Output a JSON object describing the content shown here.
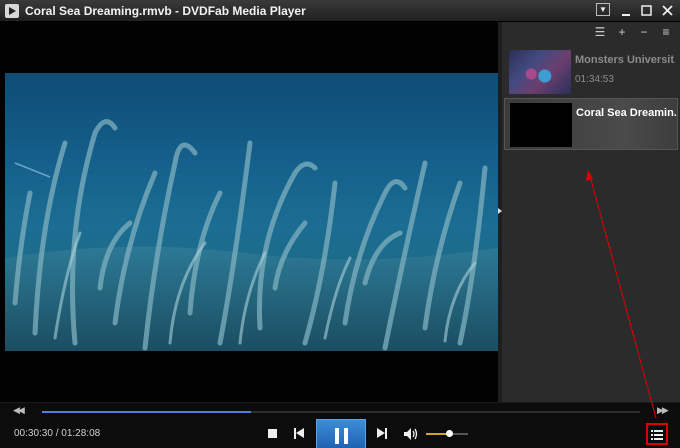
{
  "window": {
    "title": "Coral Sea Dreaming.rmvb - DVDFab Media Player",
    "controls": [
      "dropdown-icon",
      "minimize-icon",
      "maximize-icon",
      "close-icon"
    ]
  },
  "playlist": {
    "toolbar": [
      {
        "icon": "list-icon",
        "glyph": "☰"
      },
      {
        "icon": "add-icon",
        "glyph": "+"
      },
      {
        "icon": "remove-icon",
        "glyph": "−"
      },
      {
        "icon": "sort-icon",
        "glyph": "≡"
      }
    ],
    "items": [
      {
        "name": "Monsters Universit...",
        "duration": "01:34:53",
        "active": false
      },
      {
        "name": "Coral Sea Dreamin...",
        "duration": "",
        "active": true
      }
    ]
  },
  "controls": {
    "seek_back_glyph": "◀◀",
    "seek_forward_glyph": "▶▶",
    "time": "00:30:30 / 01:28:08",
    "progress": 0.35,
    "volume": 0.55
  },
  "colors": {
    "accent": "#4f7fd8",
    "play_button": "#2a77c8",
    "volume": "#d4a41e",
    "annotation": "#dd0000"
  }
}
